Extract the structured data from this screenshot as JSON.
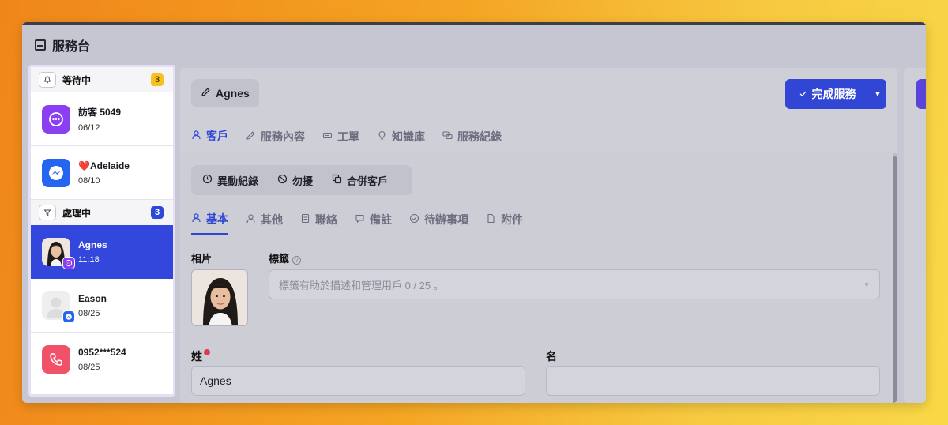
{
  "app": {
    "title": "服務台",
    "title_icon": "inbox-icon"
  },
  "sidebar": {
    "groups": [
      {
        "label": "等待中",
        "icon": "bell-icon",
        "count": "3",
        "count_color": "#f7c21f"
      },
      {
        "label": "處理中",
        "icon": "funnel-icon",
        "count": "3",
        "count_color": "#2b49d9"
      }
    ],
    "waiting": [
      {
        "name": "訪客 5049",
        "time": "06/12",
        "channel": "chat-icon",
        "color": "#8b3ff0"
      },
      {
        "name": "Adelaide",
        "heart": "❤️",
        "time": "08/10",
        "channel": "messenger-icon",
        "color": "#2465f2"
      }
    ],
    "processing": [
      {
        "name": "Agnes",
        "time": "11:18",
        "channel": "chat-icon",
        "active": true
      },
      {
        "name": "Eason",
        "time": "08/25",
        "channel": "messenger-icon"
      },
      {
        "name": "0952***524",
        "time": "08/25",
        "channel": "phone-icon",
        "color": "#f2516a"
      }
    ]
  },
  "main": {
    "customer_name": "Agnes",
    "complete_button": "完成服務",
    "tabs": [
      "客戶",
      "服務內容",
      "工單",
      "知識庫",
      "服務紀錄"
    ],
    "active_tab": "客戶",
    "actions": [
      "異動紀錄",
      "勿擾",
      "合併客戶"
    ],
    "subtabs": [
      "基本",
      "其他",
      "聯絡",
      "備註",
      "待辦事項",
      "附件"
    ],
    "active_subtab": "基本",
    "form": {
      "photo_label": "相片",
      "tags_label": "標籤",
      "tags_placeholder": "標籤有助於描述和管理用戶 0 / 25 。",
      "last_name_label": "姓",
      "last_name_value": "Agnes",
      "first_name_label": "名",
      "first_name_value": ""
    }
  },
  "colors": {
    "accent": "#3246d6",
    "required": "#e0394f"
  }
}
